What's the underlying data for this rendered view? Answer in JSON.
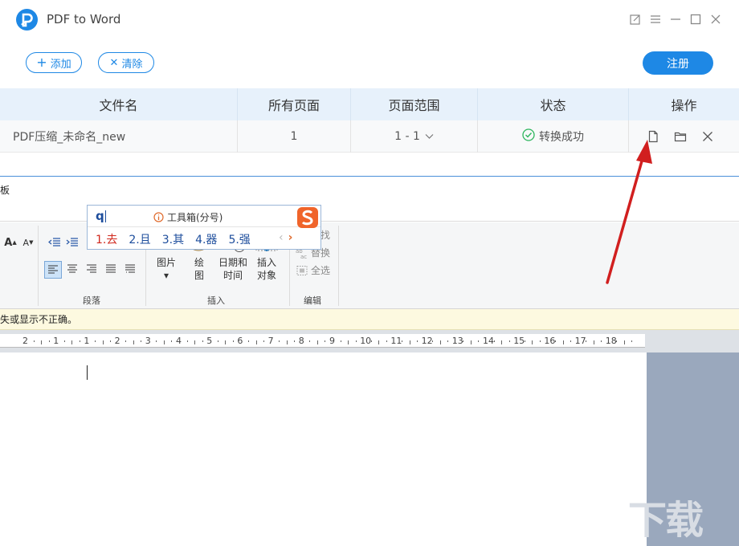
{
  "window": {
    "title": "PDF to Word",
    "add_label": "添加",
    "clear_label": "清除",
    "register_label": "注册"
  },
  "table": {
    "headers": {
      "filename": "文件名",
      "pages": "所有页面",
      "range": "页面范围",
      "status": "状态",
      "actions": "操作"
    },
    "rows": [
      {
        "filename": "PDF压缩_未命名_new",
        "pages": "1",
        "range": "1 - 1",
        "status": "转换成功",
        "status_color": "#2db55d"
      }
    ]
  },
  "editor": {
    "menu_fragment": "板",
    "groups": {
      "paragraph": "段落",
      "insert": "插入",
      "edit": "编辑"
    },
    "insert_items": [
      {
        "l1": "图片",
        "l2": "▾"
      },
      {
        "l1": "绘",
        "l2": "图"
      },
      {
        "l1": "日期和",
        "l2": "时间"
      },
      {
        "l1": "插入",
        "l2": "对象"
      }
    ],
    "edit_items": [
      "查找",
      "替换",
      "全选"
    ],
    "font_size_up": "A",
    "font_size_down": "A",
    "warning": "失或显示不正确。",
    "ruler_labels": [
      "2",
      "1",
      "1",
      "2",
      "3",
      "4",
      "5",
      "6",
      "7",
      "8",
      "9",
      "10",
      "11",
      "12",
      "13",
      "14",
      "15",
      "16",
      "17",
      "18"
    ]
  },
  "ime": {
    "input": "q",
    "toolbox": "工具箱(分号)",
    "candidates": [
      "1.去",
      "2.且",
      "3.其",
      "4.器",
      "5.强"
    ],
    "prev": "‹",
    "next": "›"
  },
  "watermark": "下载吧",
  "colors": {
    "accent": "#1e88e5",
    "header_bg": "#e7f1fb",
    "arrow": "#d11f1f"
  }
}
